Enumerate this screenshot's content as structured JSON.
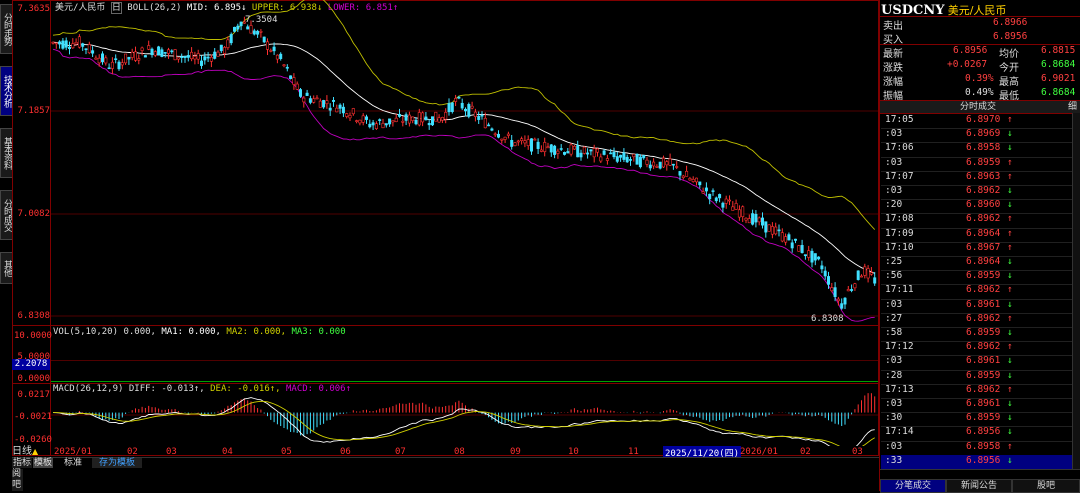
{
  "sidebar_tabs": [
    "分时走势",
    "技术分析",
    "基本资料",
    "分时成交",
    "其他"
  ],
  "chart": {
    "title": "美元/人民币",
    "period_label": "日",
    "boll_params": "BOLL(26,2)",
    "boll_mid_label": "MID: 6.895↓",
    "boll_upper_label": "UPPER: 6.938↓",
    "boll_lower_label": "LOWER: 6.851↑",
    "y_labels": [
      "7.3635",
      "7.1857",
      "7.0082",
      "6.8308"
    ],
    "high_marker": "7.3504",
    "low_marker": "6.8308",
    "vol_label": "VOL(5,10,20) 0.000, ",
    "vol_ma1": "MA1: 0.000, ",
    "vol_ma2": "MA2: 0.000, ",
    "vol_ma3": "MA3: 0.000",
    "vol_y_top": "10.0000",
    "vol_y_mid": "5.0000",
    "vol_y_bot": "0.0000",
    "vol_cursor": "2.2078",
    "macd_label": "MACD(26,12,9) DIFF: -0.013↑, ",
    "macd_dea": "DEA: -0.016↑, ",
    "macd_val": "MACD: 0.006↑",
    "macd_y": [
      "0.0217",
      "-0.0021",
      "-0.0260"
    ],
    "x_labels": [
      "2025/01",
      "02",
      "03",
      "04",
      "05",
      "06",
      "07",
      "08",
      "09",
      "10",
      "11",
      "2025/11/20(四)",
      "2026/01",
      "02",
      "03"
    ],
    "period_bar": "日线",
    "bottom_tabs": [
      "指标",
      "模板",
      "标准",
      "存为模板"
    ],
    "side_tabs": [
      "阅",
      "吧"
    ]
  },
  "quote": {
    "symbol": "USDCNY",
    "name": "美元/人民币",
    "sell_label": "卖出",
    "sell": "6.8966",
    "buy_label": "买入",
    "buy": "6.8956",
    "last_label": "最新",
    "last": "6.8956",
    "avg_label": "均价",
    "avg": "6.8815",
    "chg_label": "涨跌",
    "chg": "+0.0267",
    "open_label": "今开",
    "open": "6.8684",
    "pct_label": "涨幅",
    "pct": "0.39%",
    "high_label": "最高",
    "high": "6.9021",
    "amp_label": "振幅",
    "amp": "0.49%",
    "low_label": "最低",
    "low": "6.8684",
    "ticks_header": "分时成交",
    "ticks_more": "细"
  },
  "ticks": [
    {
      "t": "17:05",
      "p": "6.8970",
      "d": "↑"
    },
    {
      "t": ":03",
      "p": "6.8969",
      "d": "↓"
    },
    {
      "t": "17:06",
      "p": "6.8958",
      "d": "↓"
    },
    {
      "t": ":03",
      "p": "6.8959",
      "d": "↑"
    },
    {
      "t": "17:07",
      "p": "6.8963",
      "d": "↑"
    },
    {
      "t": ":03",
      "p": "6.8962",
      "d": "↓"
    },
    {
      "t": ":20",
      "p": "6.8960",
      "d": "↓"
    },
    {
      "t": "17:08",
      "p": "6.8962",
      "d": "↑"
    },
    {
      "t": "17:09",
      "p": "6.8964",
      "d": "↑"
    },
    {
      "t": "17:10",
      "p": "6.8967",
      "d": "↑"
    },
    {
      "t": ":25",
      "p": "6.8964",
      "d": "↓"
    },
    {
      "t": ":56",
      "p": "6.8959",
      "d": "↓"
    },
    {
      "t": "17:11",
      "p": "6.8962",
      "d": "↑"
    },
    {
      "t": ":03",
      "p": "6.8961",
      "d": "↓"
    },
    {
      "t": ":27",
      "p": "6.8962",
      "d": "↑"
    },
    {
      "t": ":58",
      "p": "6.8959",
      "d": "↓"
    },
    {
      "t": "17:12",
      "p": "6.8962",
      "d": "↑"
    },
    {
      "t": ":03",
      "p": "6.8961",
      "d": "↓"
    },
    {
      "t": ":28",
      "p": "6.8959",
      "d": "↓"
    },
    {
      "t": "17:13",
      "p": "6.8962",
      "d": "↑"
    },
    {
      "t": ":03",
      "p": "6.8961",
      "d": "↓"
    },
    {
      "t": ":30",
      "p": "6.8959",
      "d": "↓"
    },
    {
      "t": "17:14",
      "p": "6.8956",
      "d": "↓"
    },
    {
      "t": ":03",
      "p": "6.8958",
      "d": "↑"
    },
    {
      "t": ":33",
      "p": "6.8956",
      "d": "↓"
    }
  ],
  "right_bottom_tabs": [
    "分笔成交",
    "新闻公告",
    "股吧"
  ],
  "colors": {
    "up": "#ff4040",
    "down": "#40ff40",
    "cyan": "#40e0ff",
    "boll_upper": "#c0c000",
    "boll_lower": "#c000c0",
    "boll_mid": "#ffffff",
    "panel_border": "#800000"
  }
}
